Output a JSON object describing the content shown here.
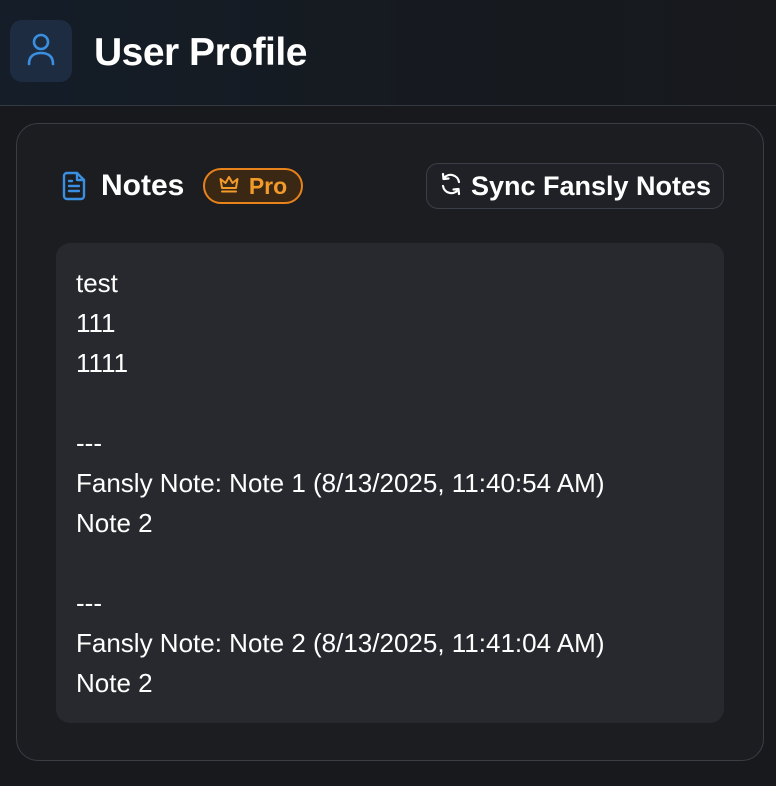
{
  "header": {
    "title": "User Profile",
    "avatar_icon": "user-icon",
    "accent": "#3b8fe0"
  },
  "notes_card": {
    "title": "Notes",
    "title_icon": "document-icon",
    "badge": {
      "label": "Pro",
      "icon": "crown-icon",
      "color": "#f29a2a"
    },
    "sync_button": {
      "label": "Sync Fansly Notes",
      "icon": "refresh-icon"
    },
    "content": "test\n111\n1111\n\n---\nFansly Note: Note 1 (8/13/2025, 11:40:54 AM)\nNote 2\n\n---\nFansly Note: Note 2 (8/13/2025, 11:41:04 AM)\nNote 2"
  }
}
